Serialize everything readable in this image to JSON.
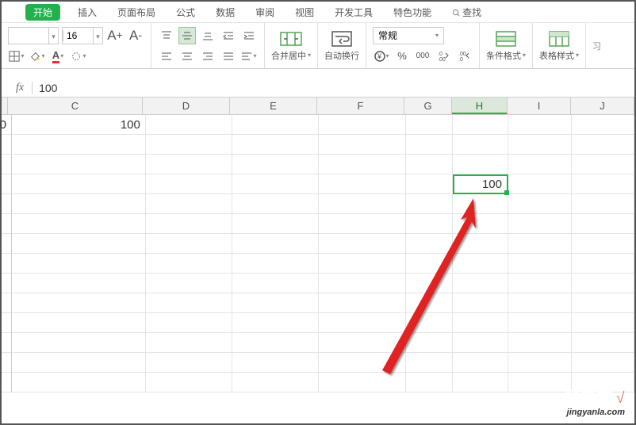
{
  "tabs": {
    "start": "开始",
    "insert": "插入",
    "layout": "页面布局",
    "formula": "公式",
    "data": "数据",
    "review": "审阅",
    "view": "视图",
    "dev": "开发工具",
    "special": "特色功能",
    "search": "查找"
  },
  "font": {
    "size": "16",
    "bigA": "A⁺",
    "smallA": "A⁻"
  },
  "merge": {
    "label": "合并居中"
  },
  "wrap": {
    "label": "自动换行"
  },
  "numfmt": {
    "label": "常规",
    "pct": "%",
    "comma": "000"
  },
  "condfmt": {
    "label": "条件格式"
  },
  "tblstyle": {
    "label": "表格样式"
  },
  "fx": {
    "symbol": "fx",
    "value": "100"
  },
  "cols": {
    "C": "C",
    "D": "D",
    "E": "E",
    "F": "F",
    "G": "G",
    "H": "H",
    "I": "I",
    "J": "J"
  },
  "cells": {
    "a1cut": "0",
    "c1": "100",
    "h3": "100"
  },
  "colw": {
    "cut": 8,
    "C": 170,
    "D": 110,
    "E": 110,
    "F": 110,
    "G": 60,
    "H": 70,
    "I": 80,
    "J": 80
  },
  "watermark": {
    "line1": "经验啦",
    "check": "√",
    "line2": "jingyanla.com"
  }
}
